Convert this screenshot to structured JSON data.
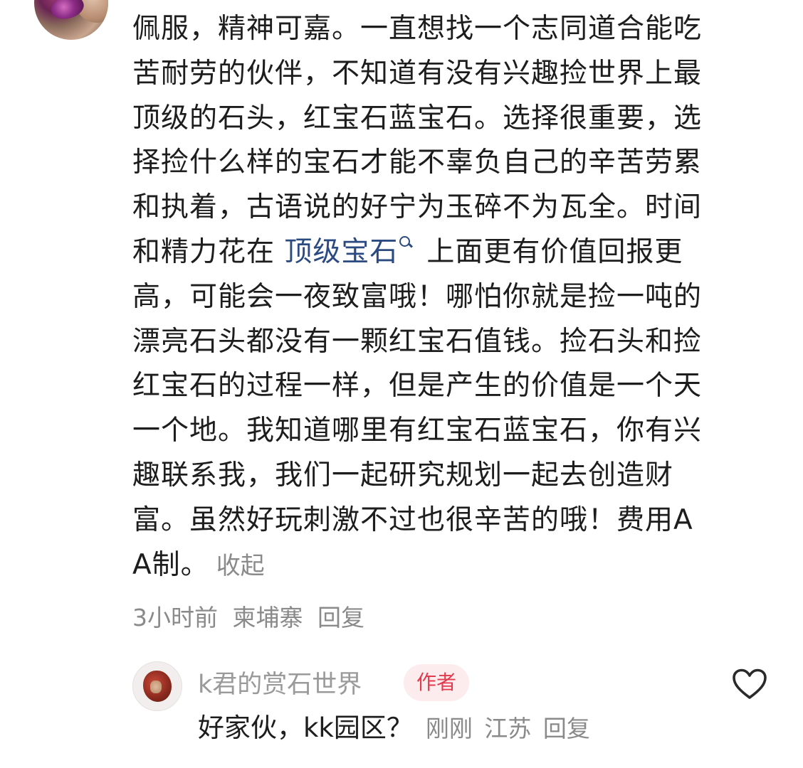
{
  "comment": {
    "text_before_link": "佩服，精神可嘉。一直想找一个志同道合能吃苦耐劳的伙伴，不知道有没有兴趣捡世界上最顶级的石头，红宝石蓝宝石。选择很重要，选择捡什么样的宝石才能不辜负自己的辛苦劳累和执着，古语说的好宁为玉碎不为瓦全。时间和精力花在 ",
    "link_text": "顶级宝石",
    "text_after_link": "上面更有价值回报更高，可能会一夜致富哦！哪怕你就是捡一吨的漂亮石头都没有一颗红宝石值钱。捡石头和捡红宝石的过程一样，但是产生的价值是一个天一个地。我知道哪里有红宝石蓝宝石，你有兴趣联系我，我们一起研究规划一起去创造财富。虽然好玩刺激不过也很辛苦的哦！费用AA制。",
    "collapse_label": "收起",
    "time": "3小时前",
    "location": "柬埔寨",
    "reply_label": "回复"
  },
  "reply": {
    "author": "k君的赏石世界",
    "badge": "作者",
    "text": "好家伙，kk园区？",
    "time": "刚刚",
    "location": "江苏",
    "reply_label": "回复",
    "like_icon": "heart-outline-icon"
  },
  "colors": {
    "link": "#2b4b80",
    "meta_gray": "#8a8a8a",
    "badge_bg": "#fdecee",
    "badge_text": "#e23b4e"
  }
}
